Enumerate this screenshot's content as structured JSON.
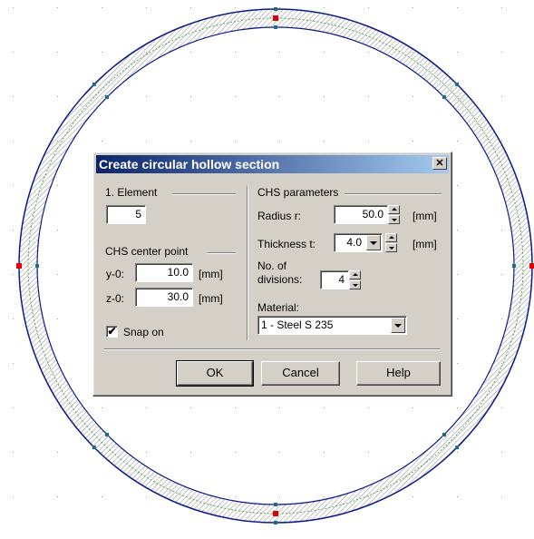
{
  "dialog": {
    "title": "Create circular hollow section",
    "close_glyph": "✕"
  },
  "element": {
    "group_label": "1. Element",
    "value": "5"
  },
  "center_point": {
    "group_label": "CHS center point",
    "y_label": "y-0:",
    "y_value": "10.0",
    "y_unit": "[mm]",
    "z_label": "z-0:",
    "z_value": "30.0",
    "z_unit": "[mm]"
  },
  "snap": {
    "label": "Snap on",
    "checked": true,
    "check_glyph": "✔"
  },
  "chs_params": {
    "group_label": "CHS parameters",
    "radius_label": "Radius r:",
    "radius_value": "50.0",
    "radius_unit": "[mm]",
    "thickness_label": "Thickness t:",
    "thickness_value": "4.0",
    "thickness_unit": "[mm]",
    "divisions_label_1": "No. of",
    "divisions_label_2": "divisions:",
    "divisions_value": "4",
    "material_label": "Material:",
    "material_value": "1 - Steel S 235"
  },
  "buttons": {
    "ok": "OK",
    "cancel": "Cancel",
    "help": "Help"
  },
  "colors": {
    "section_outline": "#0a1a8a",
    "hatch": "#8a8a8a",
    "midline": "#2ca02c",
    "node": "#1a6a8a",
    "node_highlight": "#e00000",
    "grid_dot": "#9a9a9a",
    "title_bar_start": "#0a246a",
    "title_bar_end": "#a6caf0",
    "dialog_face": "#d4d0c8"
  }
}
